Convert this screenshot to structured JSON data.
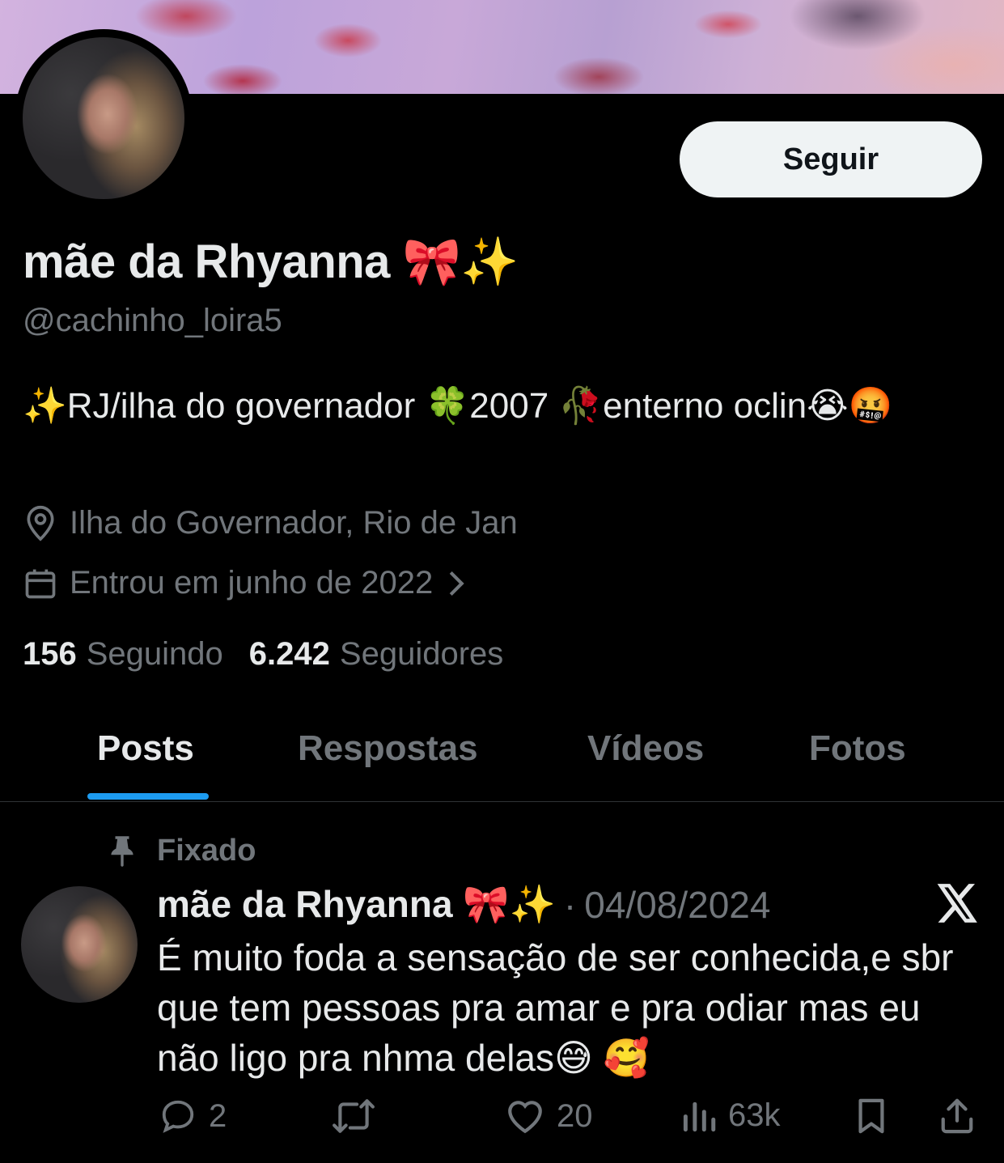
{
  "profile": {
    "display_name": "mãe da Rhyanna 🎀✨",
    "handle": "@cachinho_loira5",
    "follow_label": "Seguir",
    "bio": "✨RJ/ilha do governador 🍀2007 🥀enterno oclin😭🤬",
    "location": "Ilha do Governador, Rio de Jan",
    "joined": "Entrou em junho de 2022",
    "following_count": "156",
    "following_label": "Seguindo",
    "followers_count": "6.242",
    "followers_label": "Seguidores"
  },
  "tabs": [
    {
      "label": "Posts",
      "active": true
    },
    {
      "label": "Respostas",
      "active": false
    },
    {
      "label": "Vídeos",
      "active": false
    },
    {
      "label": "Fotos",
      "active": false
    }
  ],
  "pinned_post": {
    "pinned_label": "Fixado",
    "author": "mãe da Rhyanna 🎀✨",
    "separator": "·",
    "date": "04/08/2024",
    "text": "É muito foda a sensação de ser conhecida,e sbr que tem pessoas pra amar e pra odiar mas eu não ligo pra nhma delas😅 🥰",
    "replies": "2",
    "likes": "20",
    "views": "63k"
  },
  "icons": {
    "location": "location-pin-icon",
    "calendar": "calendar-icon",
    "chevron": "chevron-right-icon",
    "pin": "pin-icon",
    "platform": "x-logo-icon",
    "reply": "reply-icon",
    "repost": "repost-icon",
    "like": "heart-icon",
    "views": "views-icon",
    "bookmark": "bookmark-icon",
    "share": "share-icon"
  },
  "colors": {
    "accent": "#1d9bf0",
    "secondary_text": "#71767b",
    "primary_text": "#e7e9ea",
    "follow_button_bg": "#eff3f4"
  }
}
